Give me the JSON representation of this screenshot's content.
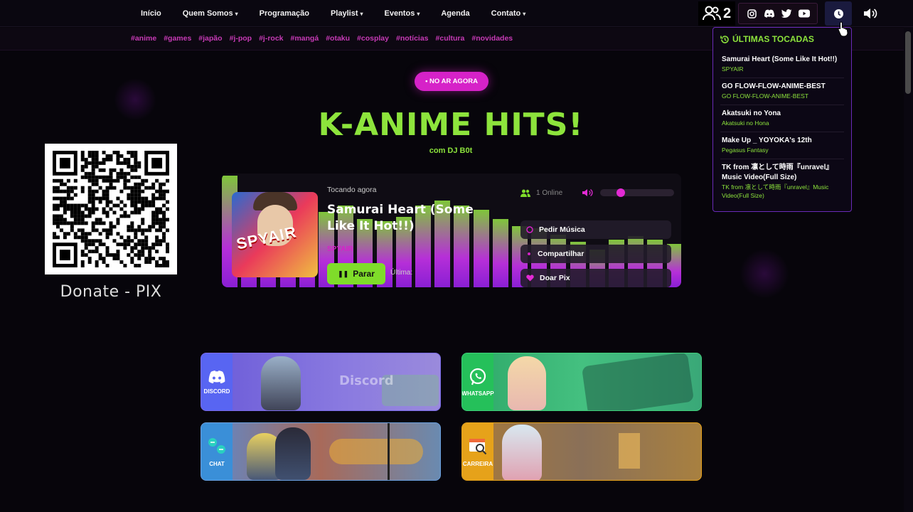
{
  "nav": {
    "items": [
      {
        "label": "Início",
        "dropdown": false
      },
      {
        "label": "Quem Somos",
        "dropdown": true
      },
      {
        "label": "Programação",
        "dropdown": false
      },
      {
        "label": "Playlist",
        "dropdown": true
      },
      {
        "label": "Eventos",
        "dropdown": true
      },
      {
        "label": "Agenda",
        "dropdown": false
      },
      {
        "label": "Contato",
        "dropdown": true
      }
    ],
    "listeners_count": "2",
    "socials": [
      "instagram-icon",
      "discord-icon",
      "twitter-icon",
      "youtube-icon"
    ]
  },
  "tags": [
    "#anime",
    "#games",
    "#japão",
    "#j-pop",
    "#j-rock",
    "#mangá",
    "#otaku",
    "#cosplay",
    "#notícias",
    "#cultura",
    "#novidades"
  ],
  "hero": {
    "onair_label": "• NO AR AGORA",
    "title": "K-ANIME HITS!",
    "subtitle": "com DJ B0t"
  },
  "qr": {
    "label": "Donate - PIX"
  },
  "player": {
    "now_label": "Tocando agora",
    "song": "Samurai Heart (Some Like It Hot!!)",
    "artist": "SPYAIR",
    "cover_text": "SPYAIR",
    "stop_label": "Parar",
    "last_label": "Última:",
    "online_label": "1 Online",
    "volume_level": 0.25,
    "actions": [
      {
        "label": "Pedir Música",
        "icon": "music-note-icon"
      },
      {
        "label": "Compartilhar",
        "icon": "share-icon"
      },
      {
        "label": "Doar Pix",
        "icon": "heart-icon"
      }
    ],
    "eq_levels": [
      0.98,
      0.7,
      0.64,
      0.62,
      0.55,
      0.66,
      0.72,
      0.6,
      0.58,
      0.62,
      0.72,
      0.76,
      0.72,
      0.68,
      0.6,
      0.54,
      0.52,
      0.46,
      0.4,
      0.33,
      0.42,
      0.45,
      0.42,
      0.38,
      0.33
    ]
  },
  "history": {
    "title": "ÚLTIMAS TOCADAS",
    "items": [
      {
        "song": "Samurai Heart (Some Like It Hot!!)",
        "artist": "SPYAIR"
      },
      {
        "song": "GO FLOW-FLOW-ANIME-BEST",
        "artist": "GO FLOW-FLOW-ANIME-BEST"
      },
      {
        "song": "Akatsuki no Yona",
        "artist": "Akatsuki no Hona"
      },
      {
        "song": "Make Up _ YOYOKA's 12th",
        "artist": "Pegasus Fantasy"
      },
      {
        "song": "TK from 凛として時雨『unravel』Music Video(Full Size)",
        "artist": "TK from 凛として時雨『unravel』Music Video(Full Size)"
      }
    ]
  },
  "cards": [
    {
      "label": "DISCORD",
      "word": "Discord",
      "color": "#5865f2"
    },
    {
      "label": "WHATSAPP",
      "word": "",
      "color": "#25c05a"
    },
    {
      "label": "CHAT",
      "word": "",
      "color": "#3a8fd8"
    },
    {
      "label": "CARREIRA",
      "word": "",
      "color": "#e6a21a"
    }
  ]
}
